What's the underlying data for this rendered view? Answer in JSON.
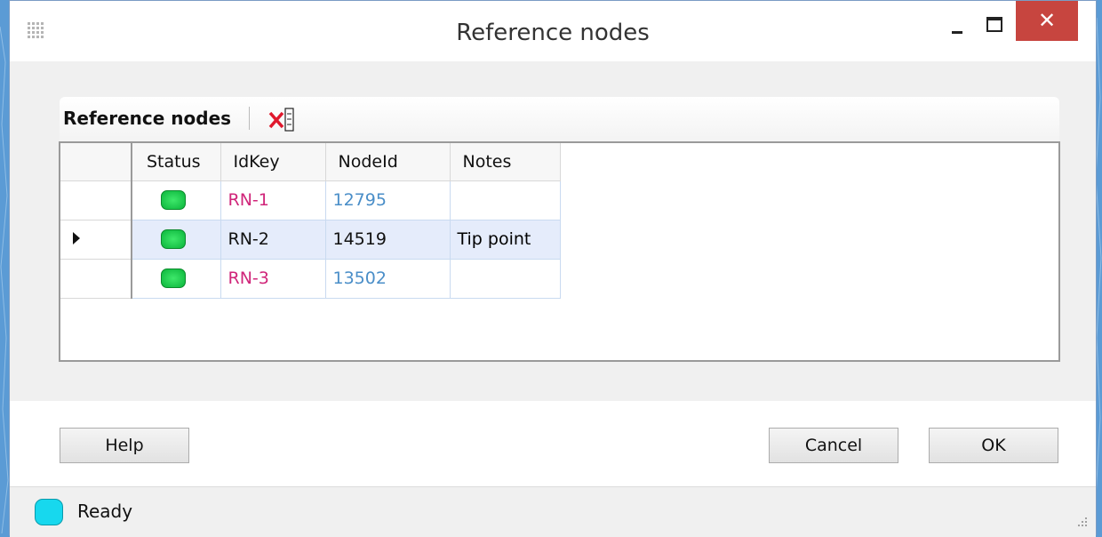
{
  "window": {
    "title": "Reference nodes",
    "close_glyph": "✕"
  },
  "panel": {
    "title": "Reference nodes"
  },
  "grid": {
    "columns": [
      "Status",
      "IdKey",
      "NodeId",
      "Notes"
    ],
    "rows": [
      {
        "status": "green",
        "idkey": "RN-1",
        "nodeid": "12795",
        "notes": ""
      },
      {
        "status": "green",
        "idkey": "RN-2",
        "nodeid": "14519",
        "notes": "Tip point",
        "selected": true
      },
      {
        "status": "green",
        "idkey": "RN-3",
        "nodeid": "13502",
        "notes": ""
      }
    ]
  },
  "buttons": {
    "help": "Help",
    "cancel": "Cancel",
    "ok": "OK"
  },
  "statusbar": {
    "text": "Ready",
    "icon_color": "#17d8ee"
  },
  "colors": {
    "idkey_text": "#d0267a",
    "nodeid_text": "#4a8ec8",
    "close_button": "#c7453f",
    "selected_row": "#e5ecfb"
  }
}
